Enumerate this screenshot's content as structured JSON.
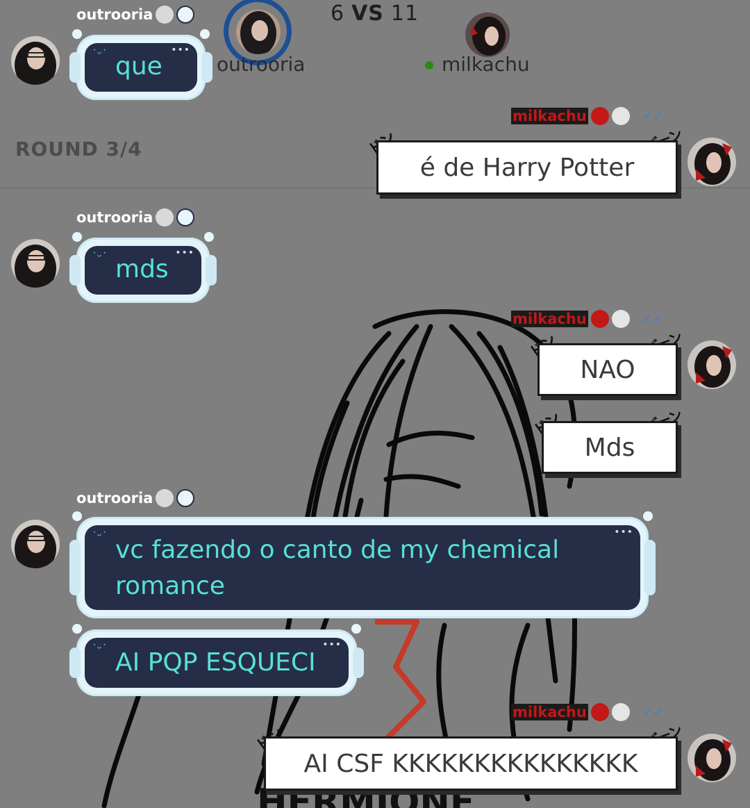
{
  "game": {
    "score_left": "6",
    "vs_label": "VS",
    "score_right": "11",
    "player_left": "outrooria",
    "player_right": "milkachu",
    "round_label": "ROUND 3/4"
  },
  "colors": {
    "background": "#7f7f7f",
    "bubble_left_bg": "#262d47",
    "bubble_left_text": "#57e1d8",
    "bubble_right_bg": "#ffffff",
    "username_right": "#c21818",
    "read_check": "#3d7fd6"
  },
  "messages": [
    {
      "sender": "outrooria",
      "text": "que"
    },
    {
      "sender": "milkachu",
      "text": "é de Harry Potter"
    },
    {
      "sender": "outrooria",
      "text": "mds"
    },
    {
      "sender": "milkachu",
      "text": "NAO"
    },
    {
      "sender": "milkachu",
      "text": "Mds"
    },
    {
      "sender": "outrooria",
      "text": "vc fazendo o canto de my chemical romance"
    },
    {
      "sender": "outrooria",
      "text": "AI PQP ESQUECI"
    },
    {
      "sender": "milkachu",
      "text": "AI CSF KKKKKKKKKKKKKKK"
    }
  ],
  "icons": {
    "bubble_face": "smile-face-icon",
    "bubble_menu": "ellipsis-icon",
    "read_status": "double-check-icon",
    "badge_left": [
      "elephant-icon",
      "robot-icon"
    ],
    "badge_right": [
      "bat-icon",
      "handshake-icon"
    ]
  },
  "glyphs": {
    "face": "˙ᵕ˙",
    "dots": "•••",
    "check": "✓✓",
    "sfx_left": "ドン",
    "sfx_right": "バーン"
  }
}
